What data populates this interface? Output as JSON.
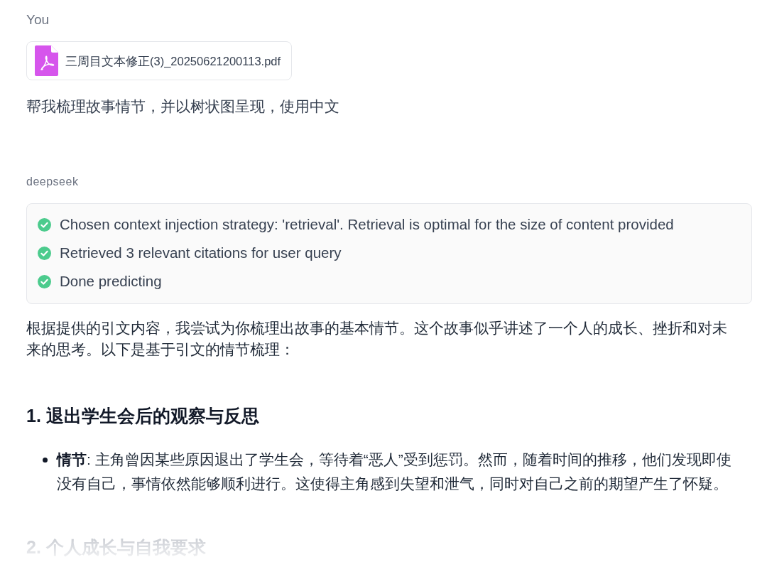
{
  "user": {
    "author": "You",
    "attachment": {
      "file_name": "三周目文本修正(3)_20250621200113.pdf"
    },
    "message": "帮我梳理故事情节，并以树状图呈现，使用中文"
  },
  "assistant": {
    "author": "deepseek",
    "steps": [
      {
        "text": "Chosen context injection strategy: 'retrieval'. Retrieval is optimal for the size of content provided",
        "done": true
      },
      {
        "text": "Retrieved 3 relevant citations for user query",
        "done": true
      },
      {
        "text": "Done predicting",
        "done": true
      }
    ],
    "intro": "根据提供的引文内容，我尝试为你梳理出故事的基本情节。这个故事似乎讲述了一个人的成长、挫折和对未来的思考。以下是基于引文的情节梳理：",
    "sections": [
      {
        "heading": "1. 退出学生会后的观察与反思",
        "faded": false,
        "bullets": [
          "**情节**: 主角曾因某些原因退出了学生会，等待着“恶人”受到惩罚。然而，随着时间的推移，他们发现即使没有自己，事情依然能够顺利进行。这使得主角感到失望和泄气，同时对自己之前的期望产生了怀疑。"
        ]
      },
      {
        "heading": "2. 个人成长与自我要求",
        "faded": true
      }
    ]
  }
}
